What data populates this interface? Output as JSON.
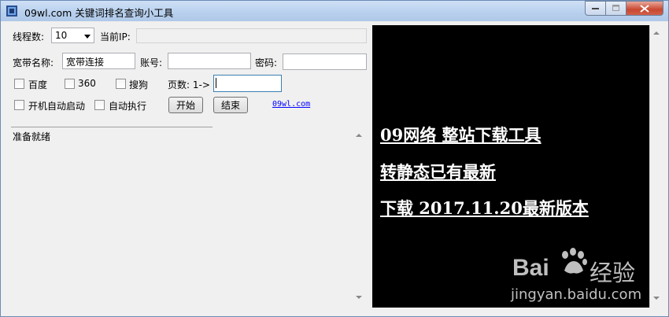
{
  "window": {
    "title": "09wl.com 关键词排名查询小工具"
  },
  "settings": {
    "threads_label": "线程数:",
    "threads_value": "10",
    "ip_label": "当前IP:",
    "ip_value": "",
    "broadband_label": "宽带名称:",
    "broadband_value": "宽带连接",
    "account_label": "账号:",
    "account_value": "",
    "password_label": "密码:",
    "password_value": ""
  },
  "engines": [
    {
      "label": "百度",
      "checked": false
    },
    {
      "label": "360",
      "checked": false
    },
    {
      "label": "搜狗",
      "checked": false
    }
  ],
  "pages": {
    "label": "页数: 1->",
    "value": ""
  },
  "options": [
    {
      "label": "开机自动启动",
      "checked": false
    },
    {
      "label": "自动执行",
      "checked": false
    }
  ],
  "buttons": {
    "start": "开始",
    "stop": "结束"
  },
  "link": "09wl.com",
  "log": {
    "text": "准备就绪"
  },
  "ad": {
    "lines": [
      "09网络 整站下载工具",
      "转静态已有最新",
      "下载 2017.11.20最新版本"
    ]
  },
  "watermark": {
    "brand": "Bai",
    "brand2": "经验",
    "url": "jingyan.baidu.com"
  }
}
